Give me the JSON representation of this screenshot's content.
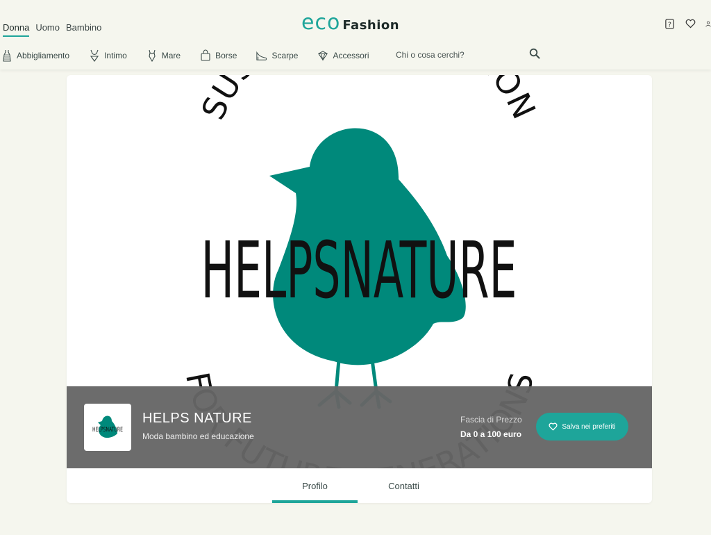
{
  "header": {
    "gender_tabs": [
      "Donna",
      "Uomo",
      "Bambino"
    ],
    "active_gender": "Donna",
    "logo": {
      "eco": "eco",
      "fashion": "Fashion"
    },
    "nav": [
      {
        "label": "Abbigliamento",
        "icon": "dress-icon"
      },
      {
        "label": "Intimo",
        "icon": "lingerie-icon"
      },
      {
        "label": "Mare",
        "icon": "swimsuit-icon"
      },
      {
        "label": "Borse",
        "icon": "bag-icon"
      },
      {
        "label": "Scarpe",
        "icon": "shoe-icon"
      },
      {
        "label": "Accessori",
        "icon": "accessories-icon"
      }
    ],
    "search_placeholder": "Chi o cosa cerchi?",
    "icons": [
      "help-icon",
      "heart-icon",
      "user-icon"
    ]
  },
  "cover": {
    "arc_top": "SUSTAINABLE FASHION",
    "logo_main": "HELPSNATURE",
    "arc_bottom": "FOR FUTURE GENERATIONS",
    "bird_color": "#00897b"
  },
  "brand": {
    "name": "HELPS NATURE",
    "description": "Moda bambino ed educazione",
    "thumb_text": "HELPSNATURE",
    "price_label": "Fascia di Prezzo",
    "price_value": "Da 0 a 100 euro",
    "save_label": "Salva nei preferiti"
  },
  "tabs": [
    {
      "label": "Profilo",
      "active": true
    },
    {
      "label": "Contatti",
      "active": false
    }
  ],
  "colors": {
    "accent": "#1ea59a",
    "background": "#f5f6ee",
    "overlay": "#666666"
  }
}
